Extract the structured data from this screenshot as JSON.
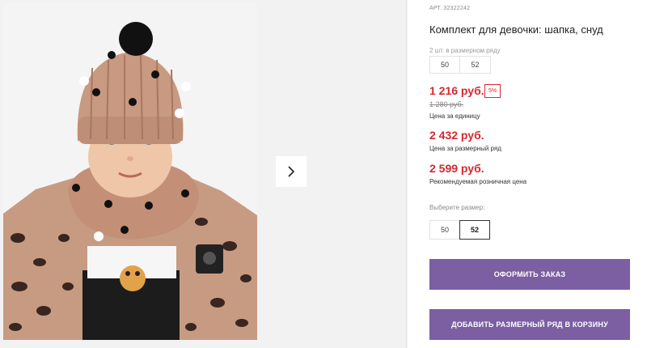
{
  "gallery": {
    "next_icon": "chevron-right-icon"
  },
  "product": {
    "sku": "АРТ. 32322242",
    "title": "Комплект для девочки: шапка, снуд",
    "row_label": "2 шт. в размерном ряду",
    "row_sizes": [
      "50",
      "52"
    ],
    "price_unit": "1 216 руб.",
    "discount": "5%",
    "price_old": "1 280 руб.",
    "price_unit_label": "Цена за единицу",
    "price_row": "2 432 руб.",
    "price_row_label": "Цена за размерный ряд",
    "price_retail": "2 599 руб.",
    "price_retail_label": "Рекомендуемая розничная цена",
    "size_select_label": "Выберите размер:",
    "size_options": [
      "50",
      "52"
    ],
    "selected_size": "52"
  },
  "actions": {
    "order_button": "ОФОРМИТЬ ЗАКАЗ",
    "add_row_button": "ДОБАВИТЬ РАЗМЕРНЫЙ РЯД В КОРЗИНУ"
  },
  "colors": {
    "price_red": "#d8262f",
    "button_purple": "#7b5fa2"
  }
}
